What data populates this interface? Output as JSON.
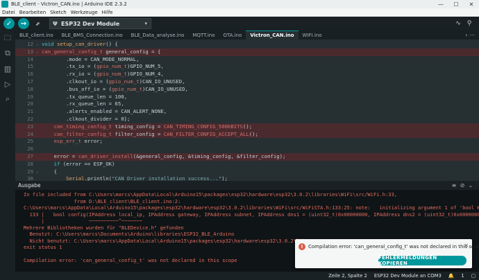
{
  "window": {
    "title": "BLE_client - Victron_CAN.ino | Arduino IDE 2.3.2",
    "minimize": "—",
    "maximize": "☐",
    "close": "✕"
  },
  "menu": [
    "Datei",
    "Bearbeiten",
    "Sketch",
    "Werkzeuge",
    "Hilfe"
  ],
  "toolbar": {
    "verify_icon": "✓",
    "upload_icon": "→",
    "debug_icon": "⬈",
    "board": "ESP32 Dev Module",
    "plug_icon": "Ψ",
    "caret": "▾",
    "right_icons": [
      "∿",
      "⚲"
    ]
  },
  "sidebar": {
    "icons": [
      "🗀",
      "⧉",
      "▥",
      "▷",
      "⌕"
    ]
  },
  "tabs": {
    "items": [
      "BLE_client.ino",
      "BLE_BMS_Connection.ino",
      "BLE_Data_analyse.ino",
      "MQTT.ino",
      "OTA.ino",
      "Victron_CAN.ino",
      "WIFI.ino"
    ],
    "active_index": 5,
    "more": "›  ⋯"
  },
  "editor": {
    "lines": [
      {
        "n": "12",
        "err": false,
        "fold": "⌄",
        "parts": [
          [
            "kw",
            "void "
          ],
          [
            "fn",
            "setup_can_driver"
          ],
          [
            "",
            "() {"
          ]
        ]
      },
      {
        "n": "13",
        "err": true,
        "fold": "⌄",
        "parts": [
          [
            "ty",
            "can_general_config_t"
          ],
          [
            "",
            " general_config = {"
          ]
        ]
      },
      {
        "n": "14",
        "err": false,
        "fold": "",
        "parts": [
          [
            "",
            "        .mode = CAN_MODE_NORMAL,"
          ]
        ]
      },
      {
        "n": "15",
        "err": false,
        "fold": "",
        "parts": [
          [
            "",
            "        .tx_io = ("
          ],
          [
            "ty",
            "gpio_num_t"
          ],
          [
            "",
            ")GPIO_NUM_5,"
          ]
        ]
      },
      {
        "n": "16",
        "err": false,
        "fold": "",
        "parts": [
          [
            "",
            "        .rx_io = ("
          ],
          [
            "ty",
            "gpio_num_t"
          ],
          [
            "",
            ")GPIO_NUM_4,"
          ]
        ]
      },
      {
        "n": "17",
        "err": false,
        "fold": "",
        "parts": [
          [
            "",
            "        .clkout_io = ("
          ],
          [
            "ty",
            "gpio_num_t"
          ],
          [
            "",
            ")CAN_IO_UNUSED,"
          ]
        ]
      },
      {
        "n": "18",
        "err": false,
        "fold": "",
        "parts": [
          [
            "",
            "        .bus_off_io = ("
          ],
          [
            "ty",
            "gpio_num_t"
          ],
          [
            "",
            ")CAN_IO_UNUSED,"
          ]
        ]
      },
      {
        "n": "19",
        "err": false,
        "fold": "",
        "parts": [
          [
            "",
            "        .tx_queue_len = 100,"
          ]
        ]
      },
      {
        "n": "20",
        "err": false,
        "fold": "",
        "parts": [
          [
            "",
            "        .rx_queue_len = 65,"
          ]
        ]
      },
      {
        "n": "21",
        "err": false,
        "fold": "",
        "parts": [
          [
            "",
            "        .alerts_enabled = CAN_ALERT_NONE,"
          ]
        ]
      },
      {
        "n": "22",
        "err": false,
        "fold": "",
        "parts": [
          [
            "",
            "        .clkout_divider = 0};"
          ]
        ]
      },
      {
        "n": "23",
        "err": true,
        "fold": "",
        "parts": [
          [
            "ty",
            "    can_timing_config_t"
          ],
          [
            "",
            " timing_config = "
          ],
          [
            "ty",
            "CAN_TIMING_CONFIG_500KBITS"
          ],
          [
            "",
            "();"
          ]
        ]
      },
      {
        "n": "24",
        "err": true,
        "fold": "",
        "parts": [
          [
            "ty",
            "    can_filter_config_t"
          ],
          [
            "",
            " filter_config = "
          ],
          [
            "ty",
            "CAN_FILTER_CONFIG_ACCEPT_ALL"
          ],
          [
            "",
            "();"
          ]
        ]
      },
      {
        "n": "25",
        "err": false,
        "fold": "",
        "parts": [
          [
            "ty",
            "    esp_err_t"
          ],
          [
            "",
            " error;"
          ]
        ]
      },
      {
        "n": "26",
        "err": false,
        "fold": "",
        "parts": [
          [
            "",
            ""
          ]
        ]
      },
      {
        "n": "27",
        "err": true,
        "fold": "",
        "parts": [
          [
            "",
            "    error = "
          ],
          [
            "ty",
            "can_driver_install"
          ],
          [
            "",
            "(&general_config, &timing_config, &filter_config);"
          ]
        ]
      },
      {
        "n": "28",
        "err": false,
        "fold": "",
        "parts": [
          [
            "kw",
            "    if"
          ],
          [
            "",
            " (error == ESP_OK)"
          ]
        ]
      },
      {
        "n": "29",
        "err": false,
        "fold": "⌄",
        "parts": [
          [
            "",
            "    {"
          ]
        ]
      },
      {
        "n": "30",
        "err": false,
        "fold": "",
        "parts": [
          [
            "fn",
            "        Serial"
          ],
          [
            "",
            ".println("
          ],
          [
            "str",
            "\"CAN Driver installation success...\""
          ],
          [
            "",
            ");"
          ]
        ]
      },
      {
        "n": "31",
        "err": false,
        "fold": "",
        "parts": [
          [
            "",
            "    }"
          ]
        ]
      }
    ]
  },
  "output": {
    "title": "Ausgabe",
    "icons": [
      "≡",
      "⊘",
      "⌄"
    ],
    "lines": [
      "In file included from C:\\Users\\marcs\\AppData\\Local\\Arduino15\\packages\\esp32\\hardware\\esp32\\3.0.2\\libraries\\WiFi\\src/WiFi.h:33,",
      "                 from D:\\BLE_client\\BLE_client.ino:2:",
      "C:\\Users\\marcs\\AppData\\Local\\Arduino15\\packages\\esp32\\hardware\\esp32\\3.0.2\\libraries\\WiFi\\src/WiFiSTA.h:133:25: note:   initializing argument 1 of 'bool WiFiSTACl",
      "  133 |   bool config(IPAddress local_ip, IPAddress gateway, IPAddress subnet, IPAddress dns1 = (uint32_t)0x00000000, IPAddress dns2 = (uint32_t)0x00000000);",
      "      |               ~~~~~~~~~~^~~~~~~~",
      "Mehrere Bibliotheken wurden für \"BLEDevice.h\" gefunden",
      "  Benutzt: C:\\Users\\marcs\\Documents\\Arduino\\libraries\\ESP32_BLE_Arduino",
      "  Nicht benutzt: C:\\Users\\marcs\\AppData\\Local\\Arduino15\\packages\\esp32\\hardware\\esp32\\3.0.2\\libra",
      "exit status 1",
      "",
      "Compilation error: 'can_general_config_t' was not declared in this scope"
    ]
  },
  "toast": {
    "icon": "!",
    "message": "Compilation error: 'can_general_config_t' was not declared in this scope",
    "close": "✕",
    "button": "FEHLERMELDUNGEN KOPIEREN"
  },
  "status": {
    "position": "Zeile 2, Spalte 2",
    "board": "ESP32 Dev Module an COM3",
    "notif_icon": "🔔",
    "count": "1",
    "layout_icon": "▢"
  }
}
